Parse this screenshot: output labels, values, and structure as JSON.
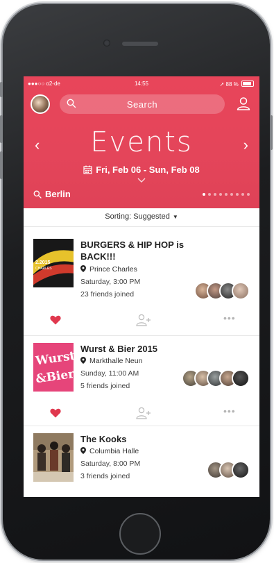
{
  "status_bar": {
    "carrier": "●●●○○ o2-de",
    "time": "14:55",
    "battery": "88 %"
  },
  "header": {
    "search_placeholder": "Search",
    "title": "Events",
    "date_range": "Fri, Feb 06 - Sun, Feb 08",
    "city": "Berlin",
    "page_dots": 9,
    "active_dot": 0,
    "background_color": "#e8455a"
  },
  "sorting": {
    "label": "Sorting: Suggested"
  },
  "events": [
    {
      "title_line1": "BURGERS & HIP HOP is",
      "title_line2": "BACK!!!",
      "venue": "Prince Charles",
      "time": "Saturday, 3:00 PM",
      "friends": "23 friends joined",
      "thumb_text": "2.2015\nCHARLES"
    },
    {
      "title_line1": "Wurst & Bier 2015",
      "title_line2": "",
      "venue": "Markthalle Neun",
      "time": "Sunday, 11:00 AM",
      "friends": "5 friends joined",
      "thumb_text": "Wurst\n& Bier"
    },
    {
      "title_line1": "The Kooks",
      "title_line2": "",
      "venue": "Columbia Halle",
      "time": "Saturday, 8:00 PM",
      "friends": "3 friends joined",
      "thumb_text": ""
    }
  ],
  "icons": {
    "search": "search-icon",
    "profile": "profile-icon",
    "calendar": "calendar-icon",
    "pin": "location-pin-icon",
    "heart": "heart-icon",
    "add_user": "add-friend-icon",
    "more": "more-icon"
  },
  "colors": {
    "accent": "#e8455a",
    "heart": "#e0384e"
  }
}
